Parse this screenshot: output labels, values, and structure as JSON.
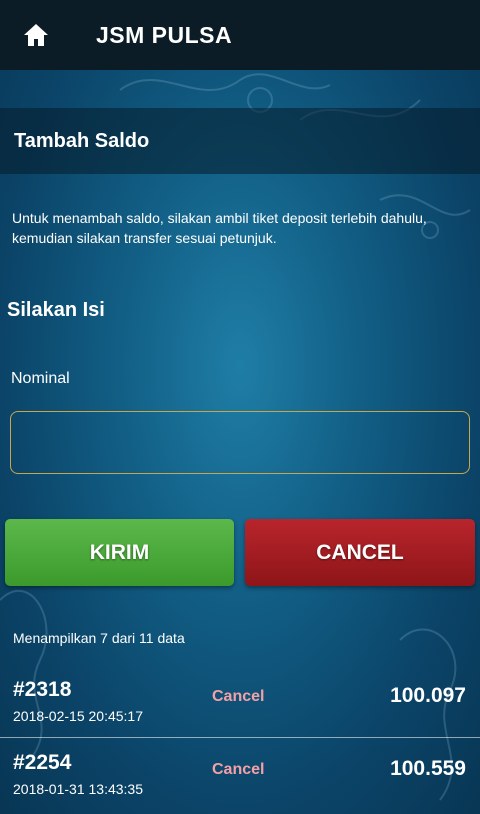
{
  "appbar": {
    "title": "JSM PULSA",
    "home_icon": "home-icon"
  },
  "section": {
    "title": "Tambah Saldo"
  },
  "info": {
    "text": "Untuk menambah saldo, silakan ambil tiket deposit terlebih dahulu, kemudian silakan transfer sesuai petunjuk."
  },
  "form": {
    "title": "Silakan Isi",
    "nominal_label": "Nominal",
    "nominal_value": "",
    "kirim_label": "KIRIM",
    "cancel_label": "CANCEL"
  },
  "list": {
    "summary": "Menampilkan 7 dari 11 data",
    "rows": [
      {
        "id": "#2318",
        "date": "2018-02-15 20:45:17",
        "action": "Cancel",
        "amount": "100.097"
      },
      {
        "id": "#2254",
        "date": "2018-01-31 13:43:35",
        "action": "Cancel",
        "amount": "100.559"
      }
    ]
  },
  "colors": {
    "appbar": "#0c1c26",
    "kirim": "#4caf3c",
    "cancel": "#a51d22",
    "input_border": "#c9a64a",
    "cancel_link": "#f4a0a6"
  }
}
